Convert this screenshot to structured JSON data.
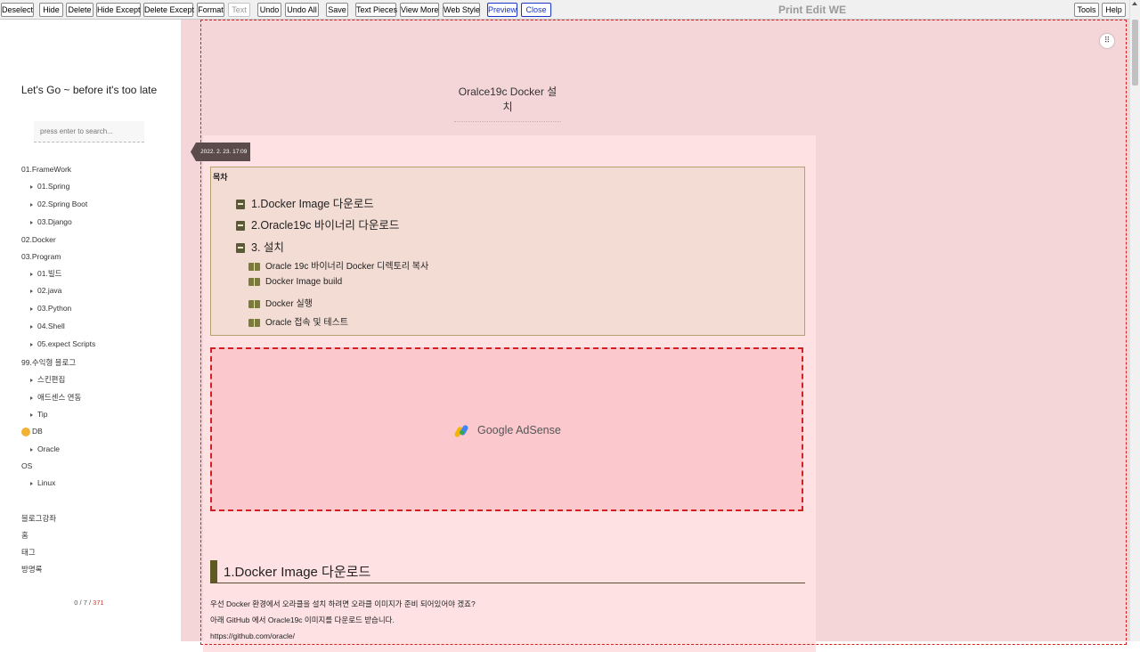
{
  "toolbar": {
    "buttons": [
      "Deselect",
      "Hide",
      "Delete",
      "Hide Except",
      "Delete Except",
      "Format",
      "Text",
      "Undo",
      "Undo All",
      "Save",
      "Text Pieces",
      "View More",
      "Web Style",
      "Preview",
      "Close"
    ],
    "title": "Print Edit WE",
    "tools_label": "Tools",
    "help_label": "Help"
  },
  "sidebar": {
    "blog_title": "Let's Go ~ before it's too late",
    "search_placeholder": "press enter to search...",
    "nav": [
      "01.FrameWork",
      "01.Spring",
      "02.Spring Boot",
      "03.Django",
      "02.Docker",
      "03.Program",
      "01.빌드",
      "02.java",
      "03.Python",
      "04.Shell",
      "05.expect Scripts",
      "99.수익형 블로그",
      "스킨편집",
      "애드센스 연동",
      "Tip",
      "DB",
      "Oracle",
      "OS",
      "Linux",
      "블로그강좌",
      "홈",
      "태그",
      "방명록"
    ],
    "counter": {
      "a": "0",
      "b": "7",
      "c": "371",
      "sep": " / "
    }
  },
  "main": {
    "post_title": "Oralce19c Docker 설치",
    "date": "2022. 2. 23. 17:09",
    "toc": {
      "title": "목차",
      "items": [
        "1.Docker Image 다운로드",
        "2.Oracle19c 바이너리 다운로드",
        "3. 설치",
        "Oracle 19c 바이너리 Docker 디렉토리 복사",
        "Docker Image build",
        "Docker 실행",
        "Oracle 접속 및 테스트"
      ]
    },
    "ad_label": "Google AdSense",
    "section_heading": "1.Docker Image 다운로드",
    "paragraphs": [
      "우선 Docker 환경에서 오라클을 설치 하려면 오라클 이미지가 준비 되어있어야 겠죠?",
      "아래 GitHub 에서 Oracle19c 이미지를 다운로드 받습니다.",
      "https://github.com/oracle/"
    ]
  }
}
